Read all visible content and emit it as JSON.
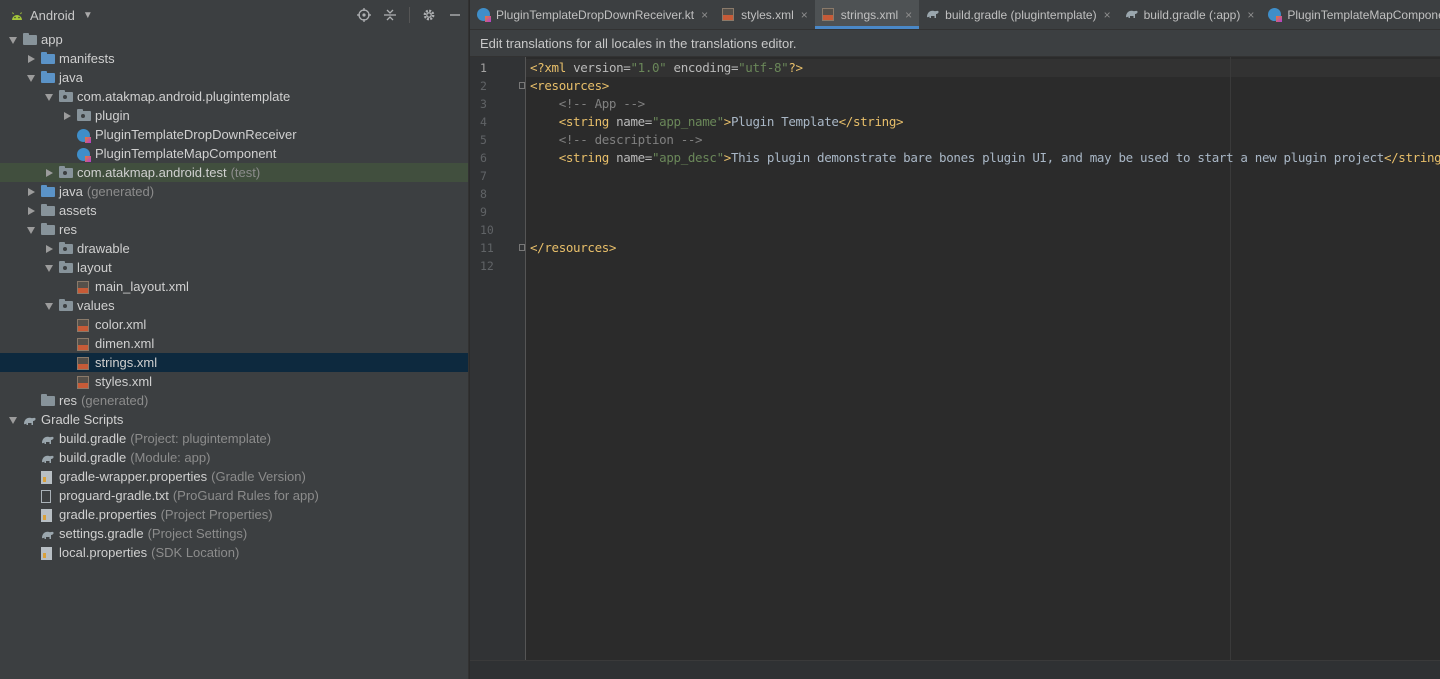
{
  "panel": {
    "title": "Android",
    "icons": [
      "android-icon",
      "locate-icon",
      "collapse-icon",
      "gear-icon",
      "minimize-icon"
    ]
  },
  "tree": [
    {
      "id": "app",
      "label": "app",
      "sub": "",
      "indent": 0,
      "arrow": "open",
      "icon": "module-folder"
    },
    {
      "id": "manifests",
      "label": "manifests",
      "sub": "",
      "indent": 1,
      "arrow": "closed",
      "icon": "blue-folder"
    },
    {
      "id": "java",
      "label": "java",
      "sub": "",
      "indent": 1,
      "arrow": "open",
      "icon": "blue-folder"
    },
    {
      "id": "pkg-plugintemplate",
      "label": "com.atakmap.android.plugintemplate",
      "sub": "",
      "indent": 2,
      "arrow": "open",
      "icon": "package"
    },
    {
      "id": "plugin",
      "label": "plugin",
      "sub": "",
      "indent": 3,
      "arrow": "closed",
      "icon": "package"
    },
    {
      "id": "dropdown-receiver",
      "label": "PluginTemplateDropDownReceiver",
      "sub": "",
      "indent": 3,
      "arrow": "none",
      "icon": "kotlin"
    },
    {
      "id": "map-component",
      "label": "PluginTemplateMapComponent",
      "sub": "",
      "indent": 3,
      "arrow": "none",
      "icon": "kotlin"
    },
    {
      "id": "pkg-test",
      "label": "com.atakmap.android.test",
      "sub": "(test)",
      "indent": 2,
      "arrow": "closed",
      "icon": "package",
      "state": "sel-light"
    },
    {
      "id": "java-generated",
      "label": "java",
      "sub": "(generated)",
      "indent": 1,
      "arrow": "closed",
      "icon": "generated-folder"
    },
    {
      "id": "assets",
      "label": "assets",
      "sub": "",
      "indent": 1,
      "arrow": "closed",
      "icon": "res-folder"
    },
    {
      "id": "res",
      "label": "res",
      "sub": "",
      "indent": 1,
      "arrow": "open",
      "icon": "res-folder"
    },
    {
      "id": "drawable",
      "label": "drawable",
      "sub": "",
      "indent": 2,
      "arrow": "closed",
      "icon": "package"
    },
    {
      "id": "layout",
      "label": "layout",
      "sub": "",
      "indent": 2,
      "arrow": "open",
      "icon": "package"
    },
    {
      "id": "main-layout",
      "label": "main_layout.xml",
      "sub": "",
      "indent": 3,
      "arrow": "none",
      "icon": "xml"
    },
    {
      "id": "values",
      "label": "values",
      "sub": "",
      "indent": 2,
      "arrow": "open",
      "icon": "package"
    },
    {
      "id": "color-xml",
      "label": "color.xml",
      "sub": "",
      "indent": 3,
      "arrow": "none",
      "icon": "xml"
    },
    {
      "id": "dimen-xml",
      "label": "dimen.xml",
      "sub": "",
      "indent": 3,
      "arrow": "none",
      "icon": "xml"
    },
    {
      "id": "strings-xml",
      "label": "strings.xml",
      "sub": "",
      "indent": 3,
      "arrow": "none",
      "icon": "xml",
      "state": "sel"
    },
    {
      "id": "styles-xml",
      "label": "styles.xml",
      "sub": "",
      "indent": 3,
      "arrow": "none",
      "icon": "xml"
    },
    {
      "id": "res-generated",
      "label": "res",
      "sub": "(generated)",
      "indent": 1,
      "arrow": "none",
      "icon": "res-folder"
    },
    {
      "id": "gradle-scripts",
      "label": "Gradle Scripts",
      "sub": "",
      "indent": 0,
      "arrow": "open",
      "icon": "gradle"
    },
    {
      "id": "build-gradle-project",
      "label": "build.gradle",
      "sub": "(Project: plugintemplate)",
      "indent": 1,
      "arrow": "none",
      "icon": "gradle"
    },
    {
      "id": "build-gradle-module",
      "label": "build.gradle",
      "sub": "(Module: app)",
      "indent": 1,
      "arrow": "none",
      "icon": "gradle"
    },
    {
      "id": "gradle-wrapper",
      "label": "gradle-wrapper.properties",
      "sub": "(Gradle Version)",
      "indent": 1,
      "arrow": "none",
      "icon": "properties"
    },
    {
      "id": "proguard",
      "label": "proguard-gradle.txt",
      "sub": "(ProGuard Rules for app)",
      "indent": 1,
      "arrow": "none",
      "icon": "text"
    },
    {
      "id": "gradle-properties",
      "label": "gradle.properties",
      "sub": "(Project Properties)",
      "indent": 1,
      "arrow": "none",
      "icon": "properties"
    },
    {
      "id": "settings-gradle",
      "label": "settings.gradle",
      "sub": "(Project Settings)",
      "indent": 1,
      "arrow": "none",
      "icon": "gradle"
    },
    {
      "id": "local-properties",
      "label": "local.properties",
      "sub": "(SDK Location)",
      "indent": 1,
      "arrow": "none",
      "icon": "properties"
    }
  ],
  "tabs": [
    {
      "id": "dropdown-receiver-kt",
      "label": "PluginTemplateDropDownReceiver.kt",
      "icon": "kotlin",
      "active": false,
      "closable": true
    },
    {
      "id": "styles-xml",
      "label": "styles.xml",
      "icon": "xml",
      "active": false,
      "closable": true
    },
    {
      "id": "strings-xml",
      "label": "strings.xml",
      "icon": "xml",
      "active": true,
      "closable": true
    },
    {
      "id": "build-gradle-plugintemplate",
      "label": "build.gradle (plugintemplate)",
      "icon": "gradle",
      "active": false,
      "closable": true
    },
    {
      "id": "build-gradle-app",
      "label": "build.gradle (:app)",
      "icon": "gradle",
      "active": false,
      "closable": true
    },
    {
      "id": "map-component-kt",
      "label": "PluginTemplateMapComponent.kt",
      "icon": "kotlin",
      "active": false,
      "closable": false
    }
  ],
  "notice": "Edit translations for all locales in the translations editor.",
  "editor": {
    "current_line": 1,
    "lines": [
      [
        {
          "t": "<?xml ",
          "c": "pi"
        },
        {
          "t": "version=",
          "c": "attr"
        },
        {
          "t": "\"1.0\"",
          "c": "val"
        },
        {
          "t": " encoding=",
          "c": "attr"
        },
        {
          "t": "\"utf-8\"",
          "c": "val"
        },
        {
          "t": "?>",
          "c": "pi"
        }
      ],
      [
        {
          "t": "<resources>",
          "c": "tag"
        }
      ],
      [
        {
          "t": "    <!-- App -->",
          "c": "com"
        }
      ],
      [
        {
          "t": "    ",
          "c": "text"
        },
        {
          "t": "<string ",
          "c": "tag"
        },
        {
          "t": "name=",
          "c": "attr"
        },
        {
          "t": "\"app_name\"",
          "c": "val"
        },
        {
          "t": ">",
          "c": "tag"
        },
        {
          "t": "Plugin Template",
          "c": "text"
        },
        {
          "t": "</string>",
          "c": "tag"
        }
      ],
      [
        {
          "t": "    <!-- description -->",
          "c": "com"
        }
      ],
      [
        {
          "t": "    ",
          "c": "text"
        },
        {
          "t": "<string ",
          "c": "tag"
        },
        {
          "t": "name=",
          "c": "attr"
        },
        {
          "t": "\"app_desc\"",
          "c": "val"
        },
        {
          "t": ">",
          "c": "tag"
        },
        {
          "t": "This plugin demonstrate bare bones plugin UI, and may be used to start a new plugin project",
          "c": "text"
        },
        {
          "t": "</string>",
          "c": "tag"
        }
      ],
      [],
      [],
      [],
      [],
      [
        {
          "t": "</resources>",
          "c": "tag"
        }
      ],
      []
    ],
    "line_numbers": [
      "1",
      "2",
      "3",
      "4",
      "5",
      "6",
      "7",
      "8",
      "9",
      "10",
      "11",
      "12"
    ]
  }
}
